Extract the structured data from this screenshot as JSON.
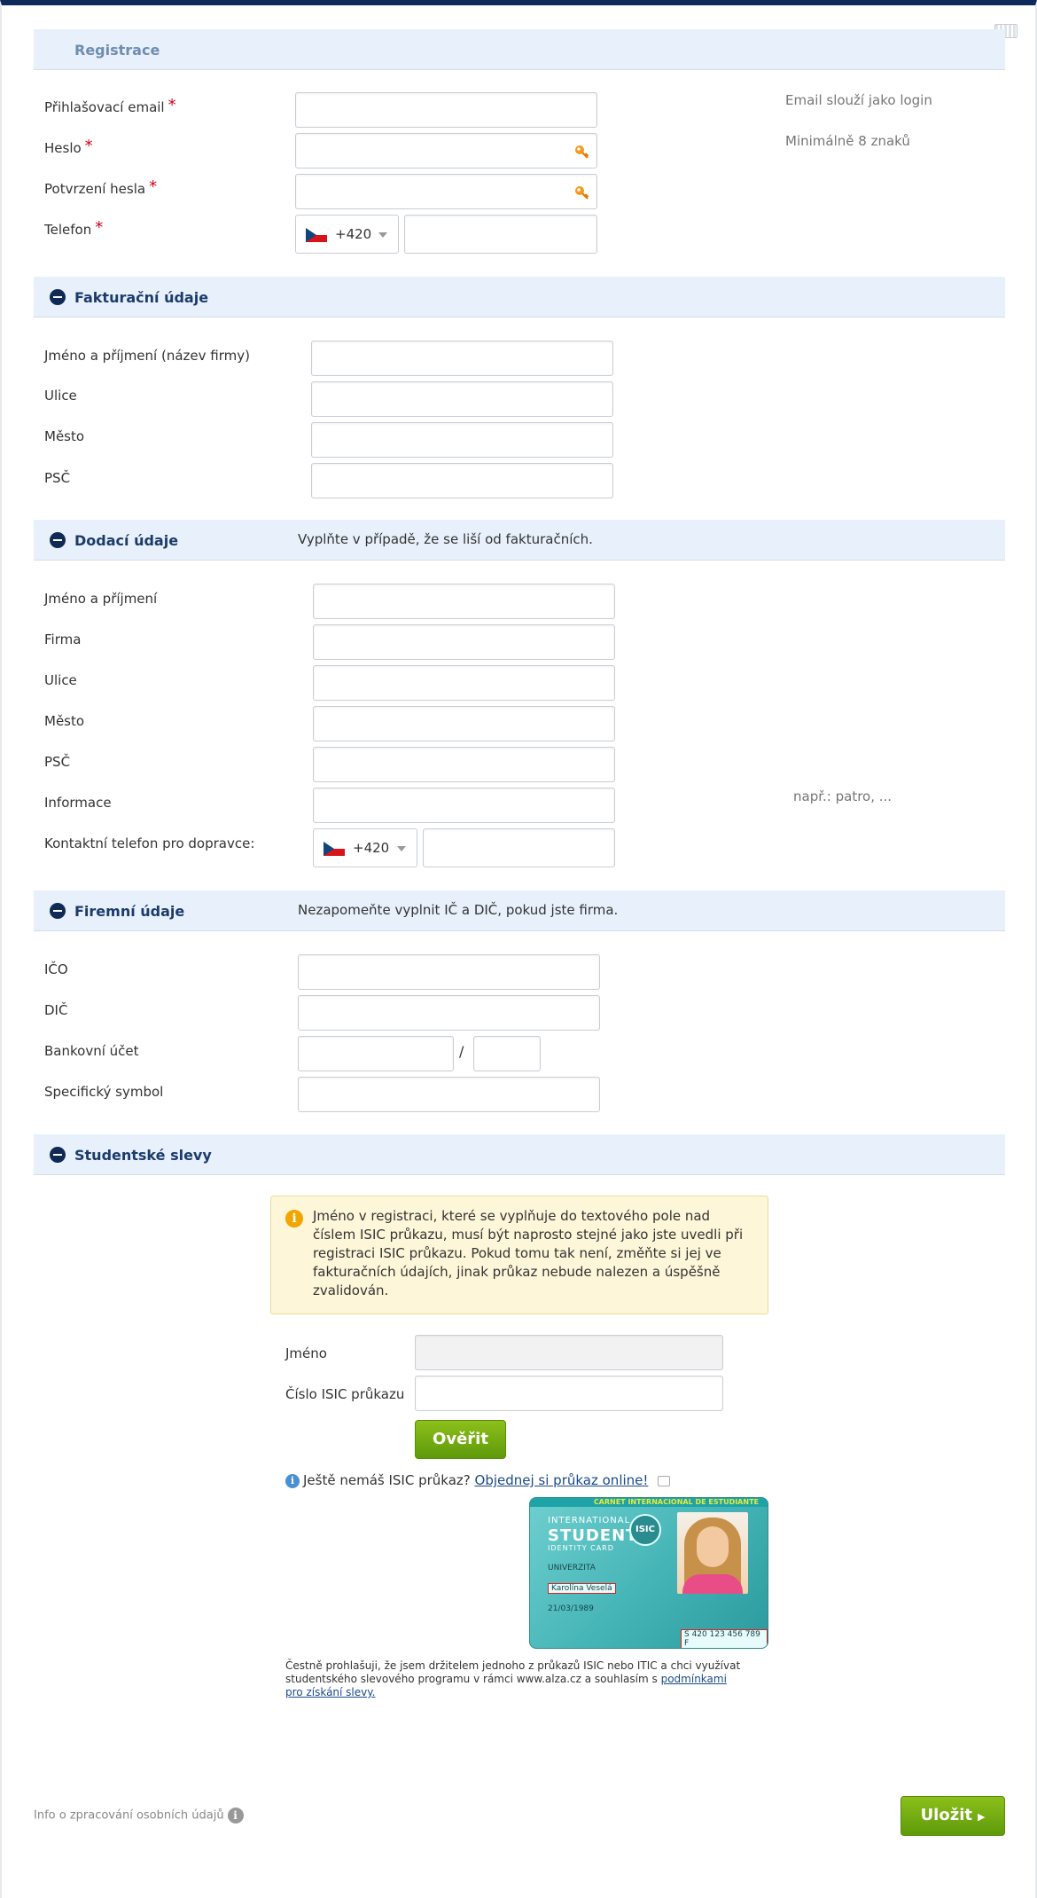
{
  "registration": {
    "title": "Registrace",
    "email_label": "Přihlašovací email",
    "password_label": "Heslo",
    "password_confirm_label": "Potvrzení hesla",
    "phone_label": "Telefon",
    "required_mark": "*",
    "phone_code": "+420",
    "email_hint": "Email slouží jako login",
    "password_hint": "Minimálně 8 znaků"
  },
  "billing": {
    "title": "Fakturační údaje",
    "name_label": "Jméno a příjmení (název firmy)",
    "street_label": "Ulice",
    "city_label": "Město",
    "zip_label": "PSČ"
  },
  "delivery": {
    "title": "Dodací údaje",
    "note": "Vyplňte v případě, že se liší od fakturačních.",
    "name_label": "Jméno a příjmení",
    "company_label": "Firma",
    "street_label": "Ulice",
    "city_label": "Město",
    "zip_label": "PSČ",
    "info_label": "Informace",
    "info_hint": "např.: patro, ...",
    "phone_label": "Kontaktní telefon pro dopravce:",
    "phone_code": "+420"
  },
  "company": {
    "title": "Firemní údaje",
    "note": "Nezapomeňte vyplnit IČ a DIČ, pokud jste firma.",
    "ico_label": "IČO",
    "dic_label": "DIČ",
    "bank_label": "Bankovní účet",
    "bank_separator": "/",
    "symbol_label": "Specifický symbol"
  },
  "student": {
    "title": "Studentské slevy",
    "info_text": "Jméno v registraci, které se vyplňuje do textového pole nad číslem ISIC průkazu, musí být naprosto stejné jako jste uvedli při registraci ISIC průkazu. Pokud tomu tak není, změňte si jej ve fakturačních údajích, jinak průkaz nebude nalezen a úspěšně zvalidován.",
    "name_label": "Jméno",
    "isic_label": "Číslo ISIC průkazu",
    "verify_button": "Ověřit",
    "no_isic_text": "Ještě nemáš ISIC průkaz?",
    "order_link": "Objednej si průkaz online!",
    "card": {
      "top_text": "CARNET INTERNACIONAL DE ESTUDIANTE",
      "international": "INTERNATIONAL",
      "student": "STUDENT",
      "identity": "IDENTITY CARD",
      "logo": "ISIC",
      "university": "UNIVERZITA",
      "name": "Karolína Veselá",
      "dob": "21/03/1989",
      "number": "S 420 123 456 789 F"
    },
    "declaration_text": "Čestně prohlašuji, že jsem držitelem jednoho z průkazů ISIC nebo ITIC a chci využívat studentského slevového programu v rámci www.alza.cz a souhlasím s",
    "declaration_link": "podmínkami pro získání slevy."
  },
  "footer": {
    "privacy_text": "Info o zpracování osobních údajů",
    "save_button": "Uložit"
  },
  "colors": {
    "section_bg": "#e8f1fb",
    "header_border": "#0d2a5a",
    "button_green": "#6fa814",
    "required": "#d0021b"
  }
}
